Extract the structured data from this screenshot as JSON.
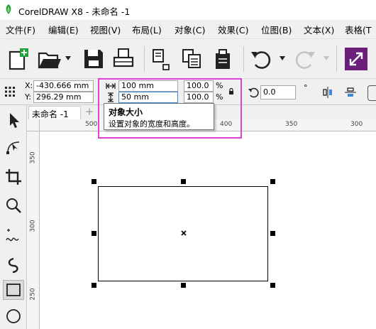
{
  "window": {
    "title": "CorelDRAW X8 - 未命名 -1"
  },
  "menu": {
    "items": [
      {
        "label": "文件(F)"
      },
      {
        "label": "编辑(E)"
      },
      {
        "label": "视图(V)"
      },
      {
        "label": "布局(L)"
      },
      {
        "label": "对象(C)"
      },
      {
        "label": "效果(C)"
      },
      {
        "label": "位图(B)"
      },
      {
        "label": "文本(X)"
      },
      {
        "label": "表格(T"
      }
    ]
  },
  "property_bar": {
    "x_label": "X:",
    "x_value": "-430.666 mm",
    "y_label": "Y:",
    "y_value": "296.29 mm",
    "width_value": "100 mm",
    "height_value": "50 mm",
    "scale_x": "100.0",
    "scale_y": "100.0",
    "percent_symbol": "%",
    "rotation_value": "0.0",
    "degree_symbol": "°"
  },
  "tooltip": {
    "title": "对象大小",
    "description": "设置对象的宽度和高度。"
  },
  "document": {
    "tab_label": "未命名 -1",
    "add_tab": "+"
  },
  "ruler": {
    "horizontal_ticks": [
      "500",
      "400",
      "350",
      "300"
    ],
    "vertical_ticks": [
      "350",
      "300",
      "250"
    ]
  },
  "colors": {
    "highlight": "#e040d8",
    "accent_green": "#21a038",
    "accent_purple": "#6a1f7a",
    "focus_border": "#3c8ad8"
  },
  "icons": {
    "toolbar": [
      "new-document-icon",
      "open-folder-icon",
      "save-icon",
      "print-icon",
      "import-icon",
      "export-icon",
      "publish-pdf-icon",
      "undo-icon",
      "redo-icon",
      "quick-launch-icon"
    ],
    "toolbox": [
      "pick-tool-icon",
      "shape-tool-icon",
      "crop-tool-icon",
      "zoom-tool-icon",
      "freehand-tool-icon",
      "artistic-media-icon",
      "rectangle-tool-icon",
      "ellipse-tool-icon"
    ]
  }
}
